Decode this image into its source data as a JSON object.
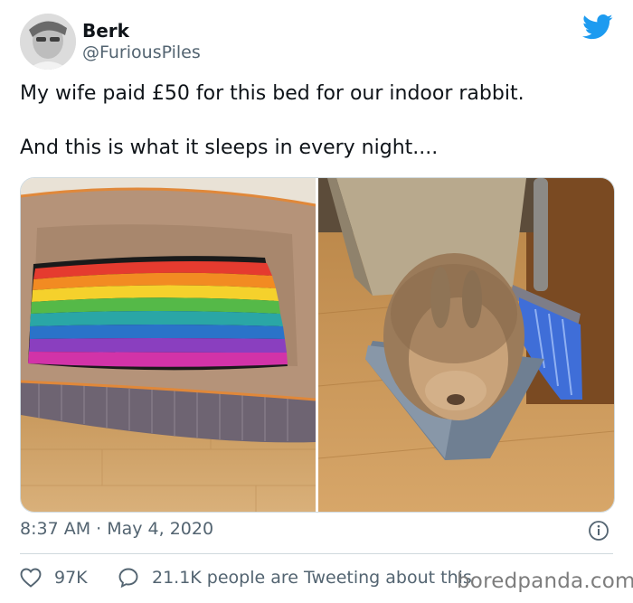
{
  "tweet": {
    "display_name": "Berk",
    "handle": "@FuriousPiles",
    "text": "My wife paid £50 for this bed for our indoor rabbit.\n\nAnd this is what it sleeps in every night....",
    "timestamp": "8:37 AM · May 4, 2020",
    "likes": "97K",
    "discussion": "21.1K people are Tweeting about this"
  },
  "icons": {
    "brand": "twitter-bird-icon",
    "info": "info-icon",
    "like": "heart-icon",
    "reply": "speech-bubble-icon"
  },
  "colors": {
    "brand_blue": "#1d9bf0",
    "secondary_text": "#536471",
    "divider": "#cfd9de"
  },
  "watermark": "boredpanda.com"
}
